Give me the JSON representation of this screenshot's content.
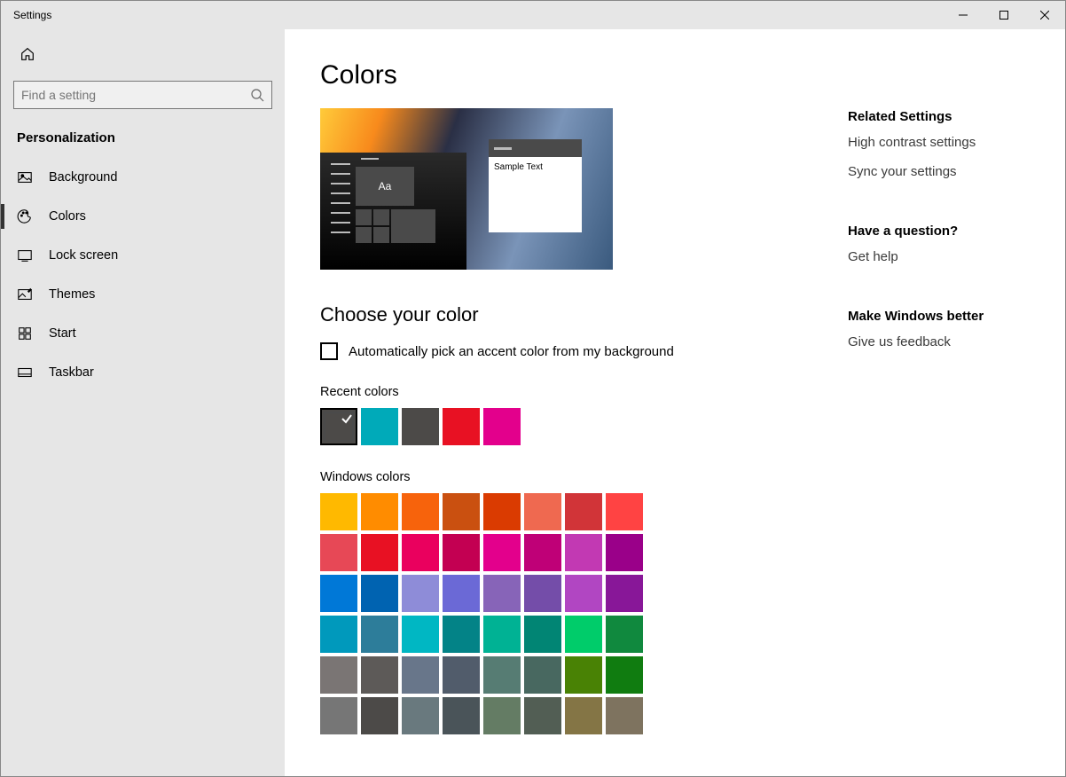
{
  "window": {
    "title": "Settings"
  },
  "search": {
    "placeholder": "Find a setting"
  },
  "category": "Personalization",
  "sidebar": {
    "items": [
      {
        "label": "Background",
        "icon": "picture",
        "active": false
      },
      {
        "label": "Colors",
        "icon": "palette",
        "active": true
      },
      {
        "label": "Lock screen",
        "icon": "lockscreen",
        "active": false
      },
      {
        "label": "Themes",
        "icon": "themes",
        "active": false
      },
      {
        "label": "Start",
        "icon": "start",
        "active": false
      },
      {
        "label": "Taskbar",
        "icon": "taskbar",
        "active": false
      }
    ]
  },
  "page": {
    "title": "Colors",
    "preview": {
      "big_tile_text": "Aa",
      "sample_text": "Sample Text"
    },
    "choose_heading": "Choose your color",
    "auto_pick_label": "Automatically pick an accent color from my background",
    "auto_pick_checked": false,
    "recent_label": "Recent colors",
    "recent_colors": [
      {
        "hex": "#4c4a48",
        "selected": true
      },
      {
        "hex": "#00aab9",
        "selected": false
      },
      {
        "hex": "#4c4a48",
        "selected": false
      },
      {
        "hex": "#e81123",
        "selected": false
      },
      {
        "hex": "#e3008c",
        "selected": false
      }
    ],
    "windows_label": "Windows colors",
    "windows_colors": [
      "#ffb900",
      "#ff8c00",
      "#f7630c",
      "#ca5010",
      "#da3b01",
      "#ef6950",
      "#d13438",
      "#ff4343",
      "#e74856",
      "#e81123",
      "#ea005e",
      "#c30052",
      "#e3008c",
      "#bf0077",
      "#c239b3",
      "#9a0089",
      "#0078d7",
      "#0063b1",
      "#8e8cd8",
      "#6b69d6",
      "#8764b8",
      "#744da9",
      "#b146c2",
      "#881798",
      "#0099bc",
      "#2d7d9a",
      "#00b7c3",
      "#038387",
      "#00b294",
      "#018574",
      "#00cc6a",
      "#10893e",
      "#7a7574",
      "#5d5a58",
      "#68768a",
      "#515c6b",
      "#567c73",
      "#486860",
      "#498205",
      "#107c10",
      "#767676",
      "#4c4a48",
      "#69797e",
      "#4a5459",
      "#647c64",
      "#525e54",
      "#847545",
      "#7e735f"
    ]
  },
  "aside": {
    "related_heading": "Related Settings",
    "related_links": [
      "High contrast settings",
      "Sync your settings"
    ],
    "question_heading": "Have a question?",
    "question_link": "Get help",
    "better_heading": "Make Windows better",
    "better_link": "Give us feedback"
  }
}
